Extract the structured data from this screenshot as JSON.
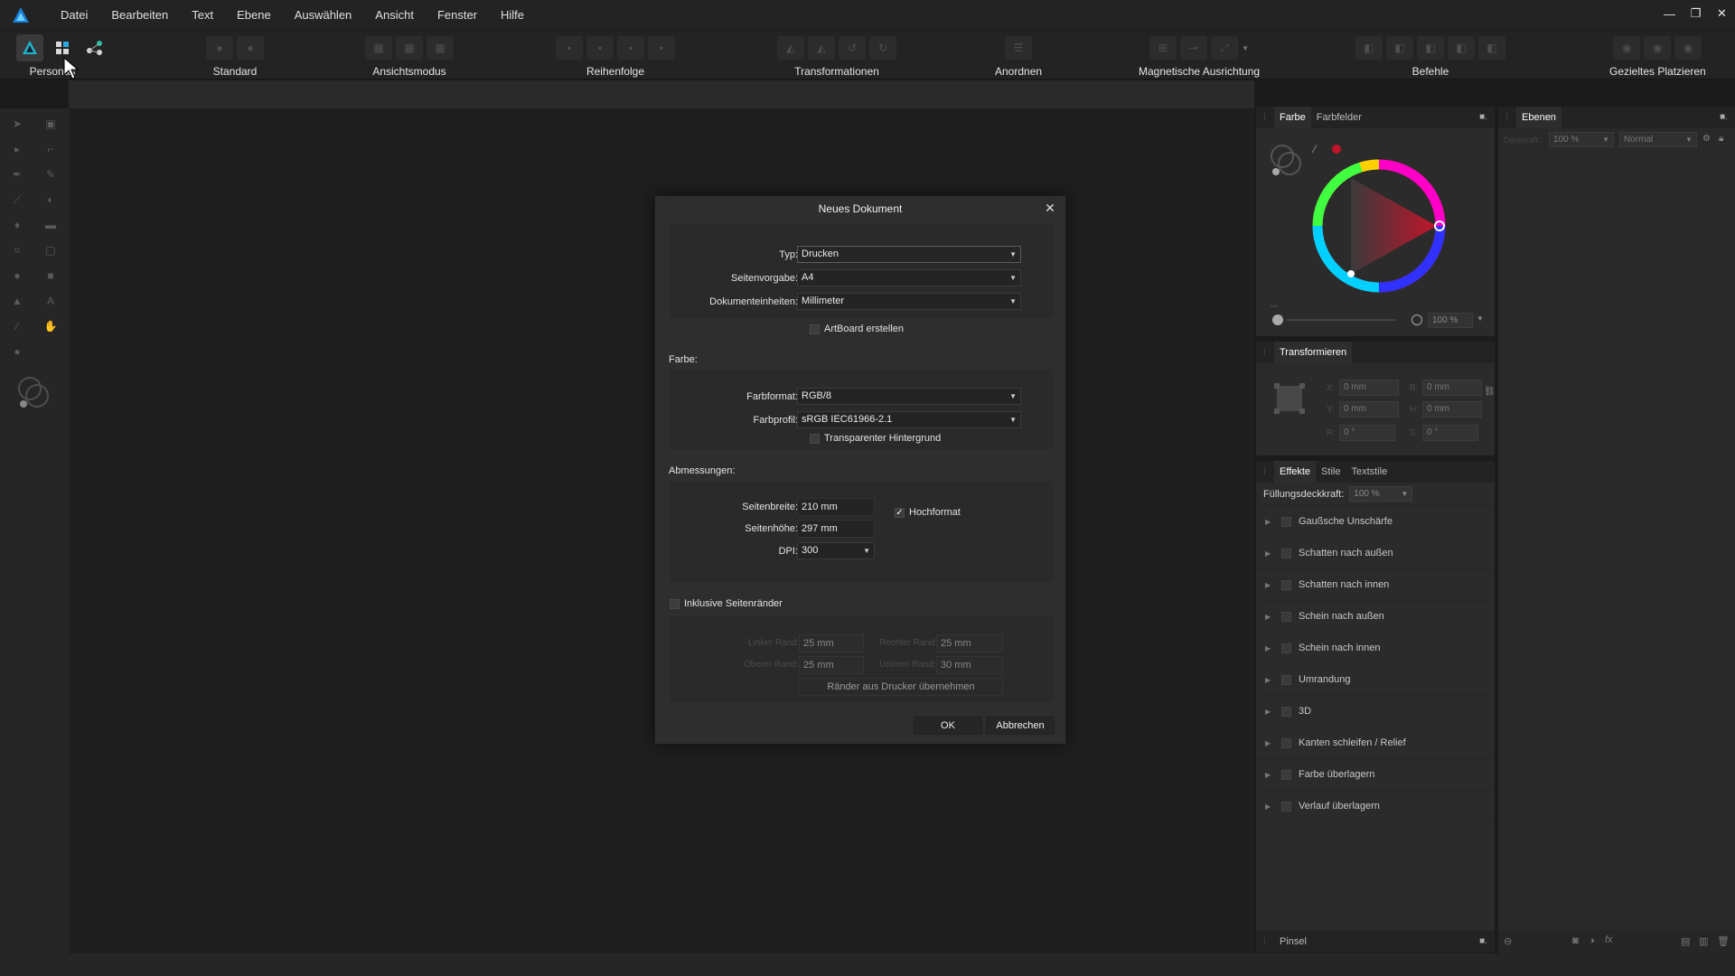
{
  "menu": {
    "items": [
      "Datei",
      "Bearbeiten",
      "Text",
      "Ebene",
      "Auswählen",
      "Ansicht",
      "Fenster",
      "Hilfe"
    ]
  },
  "window": {
    "minimize": "—",
    "restore": "❐",
    "close": "✕"
  },
  "toolbar": {
    "persona_label": "Personas",
    "groups": [
      "Standard",
      "Ansichtsmodus",
      "Reihenfolge",
      "Transformationen",
      "Anordnen",
      "Magnetische Ausrichtung",
      "Befehle",
      "Gezieltes Platzieren"
    ]
  },
  "color_panel": {
    "tabs": [
      "Farbe",
      "Farbfelder"
    ],
    "opacity_value": "100 %",
    "colors": {
      "selected": "#c0152a"
    }
  },
  "layers_panel": {
    "tab": "Ebenen",
    "opacity_label": "Deckkraft:",
    "opacity_value": "100 %",
    "blend_mode": "Normal"
  },
  "transform_panel": {
    "tab": "Transformieren",
    "x_label": "X:",
    "y_label": "Y:",
    "w_label": "B:",
    "h_label": "H:",
    "r_label": "R:",
    "s_label": "S:",
    "x": "0 mm",
    "y": "0 mm",
    "w": "0 mm",
    "h": "0 mm",
    "r": "0 °",
    "s": "0 °"
  },
  "effects_panel": {
    "tabs": [
      "Effekte",
      "Stile",
      "Textstile"
    ],
    "fill_opacity_label": "Füllungsdeckkraft:",
    "fill_opacity_value": "100 %",
    "effects": [
      "Gaußsche Unschärfe",
      "Schatten nach außen",
      "Schatten nach innen",
      "Schein nach außen",
      "Schein nach innen",
      "Umrandung",
      "3D",
      "Kanten schleifen / Relief",
      "Farbe überlagern",
      "Verlauf überlagern"
    ]
  },
  "brush_panel": {
    "tab": "Pinsel"
  },
  "dialog": {
    "title": "Neues Dokument",
    "close": "✕",
    "type_label": "Typ:",
    "type_value": "Drucken",
    "preset_label": "Seitenvorgabe:",
    "preset_value": "A4",
    "units_label": "Dokumenteinheiten:",
    "units_value": "Millimeter",
    "artboard_label": "ArtBoard erstellen",
    "color_section": "Farbe:",
    "color_format_label": "Farbformat:",
    "color_format_value": "RGB/8",
    "color_profile_label": "Farbprofil:",
    "color_profile_value": "sRGB IEC61966-2.1",
    "transparent_label": "Transparenter Hintergrund",
    "dimensions_section": "Abmessungen:",
    "width_label": "Seitenbreite:",
    "width_value": "210 mm",
    "height_label": "Seitenhöhe:",
    "height_value": "297 mm",
    "dpi_label": "DPI:",
    "dpi_value": "300",
    "portrait_label": "Hochformat",
    "portrait_checked": "✓",
    "margins_label": "Inklusive Seitenränder",
    "left_margin_label": "Linker Rand:",
    "left_margin_value": "25 mm",
    "right_margin_label": "Rechter Rand:",
    "right_margin_value": "25 mm",
    "top_margin_label": "Oberer Rand:",
    "top_margin_value": "25 mm",
    "bottom_margin_label": "Unterer Rand:",
    "bottom_margin_value": "30 mm",
    "printer_margins_button": "Ränder aus Drucker übernehmen",
    "ok_button": "OK",
    "cancel_button": "Abbrechen"
  }
}
